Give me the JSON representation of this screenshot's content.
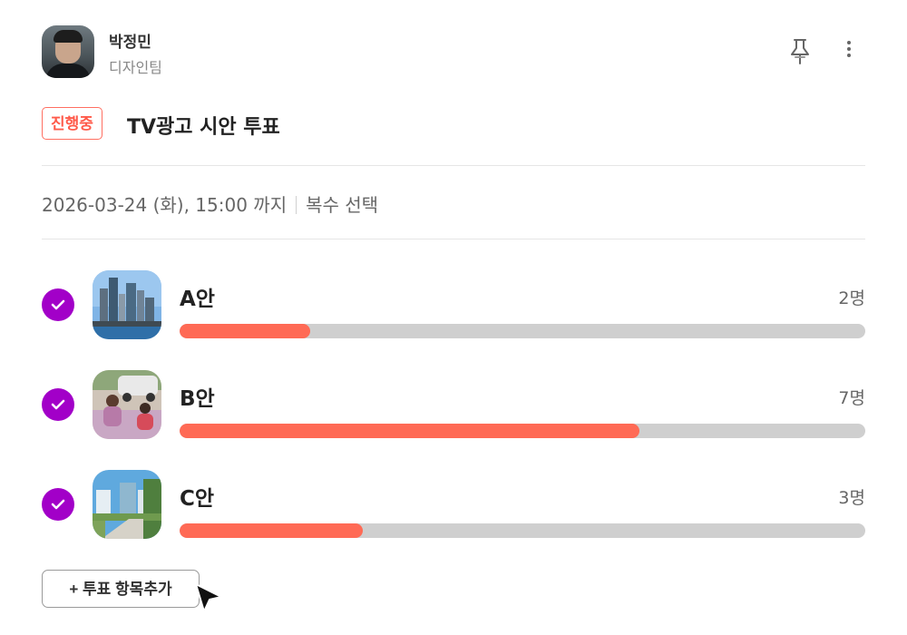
{
  "author": {
    "name": "박정민",
    "team": "디자인팀"
  },
  "poll": {
    "status": "진행중",
    "title": "TV광고 시안 투표",
    "deadline": "2026-03-24 (화), 15:00 까지",
    "mode": "복수 선택"
  },
  "options": [
    {
      "label": "A안",
      "count": "2명",
      "votes": 2,
      "progress": 0.19,
      "checked": true
    },
    {
      "label": "B안",
      "count": "7명",
      "votes": 7,
      "progress": 0.67,
      "checked": true
    },
    {
      "label": "C안",
      "count": "3명",
      "votes": 3,
      "progress": 0.267,
      "checked": true
    }
  ],
  "add_option_button": "+  투표 항목추가",
  "icons": {
    "pin": "pin-icon",
    "more": "more-vertical-icon",
    "check": "check-icon",
    "cursor": "mouse-pointer-icon"
  },
  "colors": {
    "accent": "#a200c8",
    "bar": "#ff6a55",
    "status": "#ff5a4a"
  }
}
